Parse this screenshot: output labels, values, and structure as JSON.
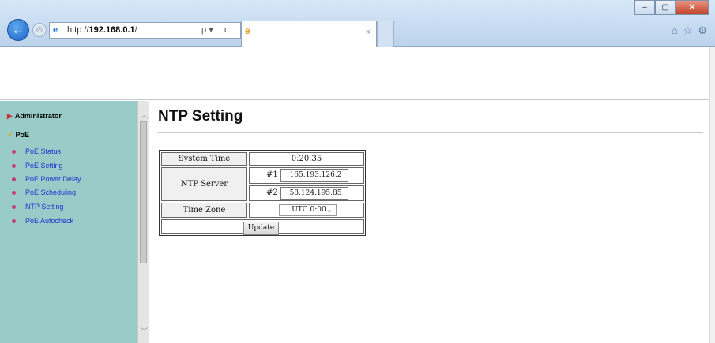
{
  "browser": {
    "back_glyph": "←",
    "forward_glyph": "⊝",
    "address_prefix": "http://",
    "address_host": "192.168.0.1",
    "address_suffix": "/",
    "search_glyph": "ρ ▾",
    "refresh_glyph": "c",
    "tab_close": "×",
    "window_buttons": {
      "minimize": "–",
      "maximize": "▢",
      "close": "✕"
    },
    "toolbar_icons": {
      "home": "⌂",
      "favorites": "☆",
      "settings": "⚙"
    }
  },
  "sidebar": {
    "sections": [
      {
        "label": "Administrator",
        "marker": "▶"
      },
      {
        "label": "PoE",
        "marker": "✓"
      }
    ],
    "items": [
      {
        "label": "PoE Status"
      },
      {
        "label": "PoE Setting"
      },
      {
        "label": "PoE Power Delay"
      },
      {
        "label": "PoE Scheduling"
      },
      {
        "label": "NTP Setting"
      },
      {
        "label": "PoE Autocheck"
      }
    ]
  },
  "main": {
    "title": "NTP Setting",
    "system_time_label": "System Time",
    "system_time_value": "0:20:35",
    "ntp_server_label": "NTP Server",
    "server1_index": "#1",
    "server1_value": "165.193.126.2",
    "server2_index": "#2",
    "server2_value": "58.124.195.85",
    "time_zone_label": "Time Zone",
    "time_zone_value": "UTC 0:00",
    "update_label": "Update"
  },
  "colors": {
    "sidebar_bg": "#99ccc8",
    "sidebar_link": "#2233cc",
    "close_button": "#c2432c"
  }
}
